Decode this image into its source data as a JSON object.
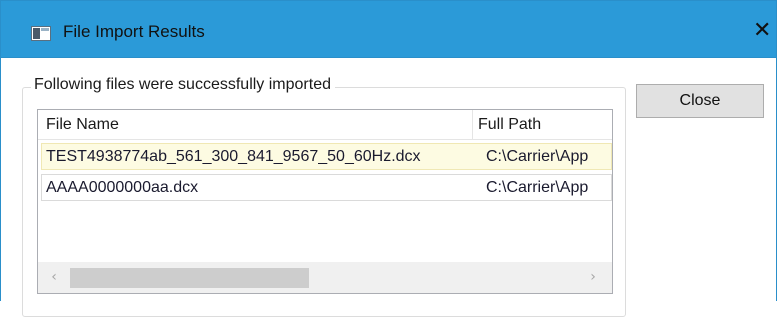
{
  "window": {
    "title": "File Import Results",
    "close_glyph": "✕",
    "icon": "window-app-icon"
  },
  "group": {
    "caption": "Following files were successfully imported"
  },
  "table": {
    "columns": [
      "File Name",
      "Full Path"
    ],
    "rows": [
      {
        "file_name": "TEST4938774ab_561_300_841_9567_50_60Hz.dcx",
        "full_path": "C:\\Carrier\\App",
        "selected": true
      },
      {
        "file_name": "AAAA0000000aa.dcx",
        "full_path": "C:\\Carrier\\App",
        "selected": false
      }
    ]
  },
  "scrollbar": {
    "left_arrow": "‹",
    "right_arrow": "›"
  },
  "buttons": {
    "close_label": "Close"
  },
  "colors": {
    "titlebar": "#2b9ad8",
    "selected_row": "#fdfbe2",
    "button": "#e1e1e1"
  }
}
